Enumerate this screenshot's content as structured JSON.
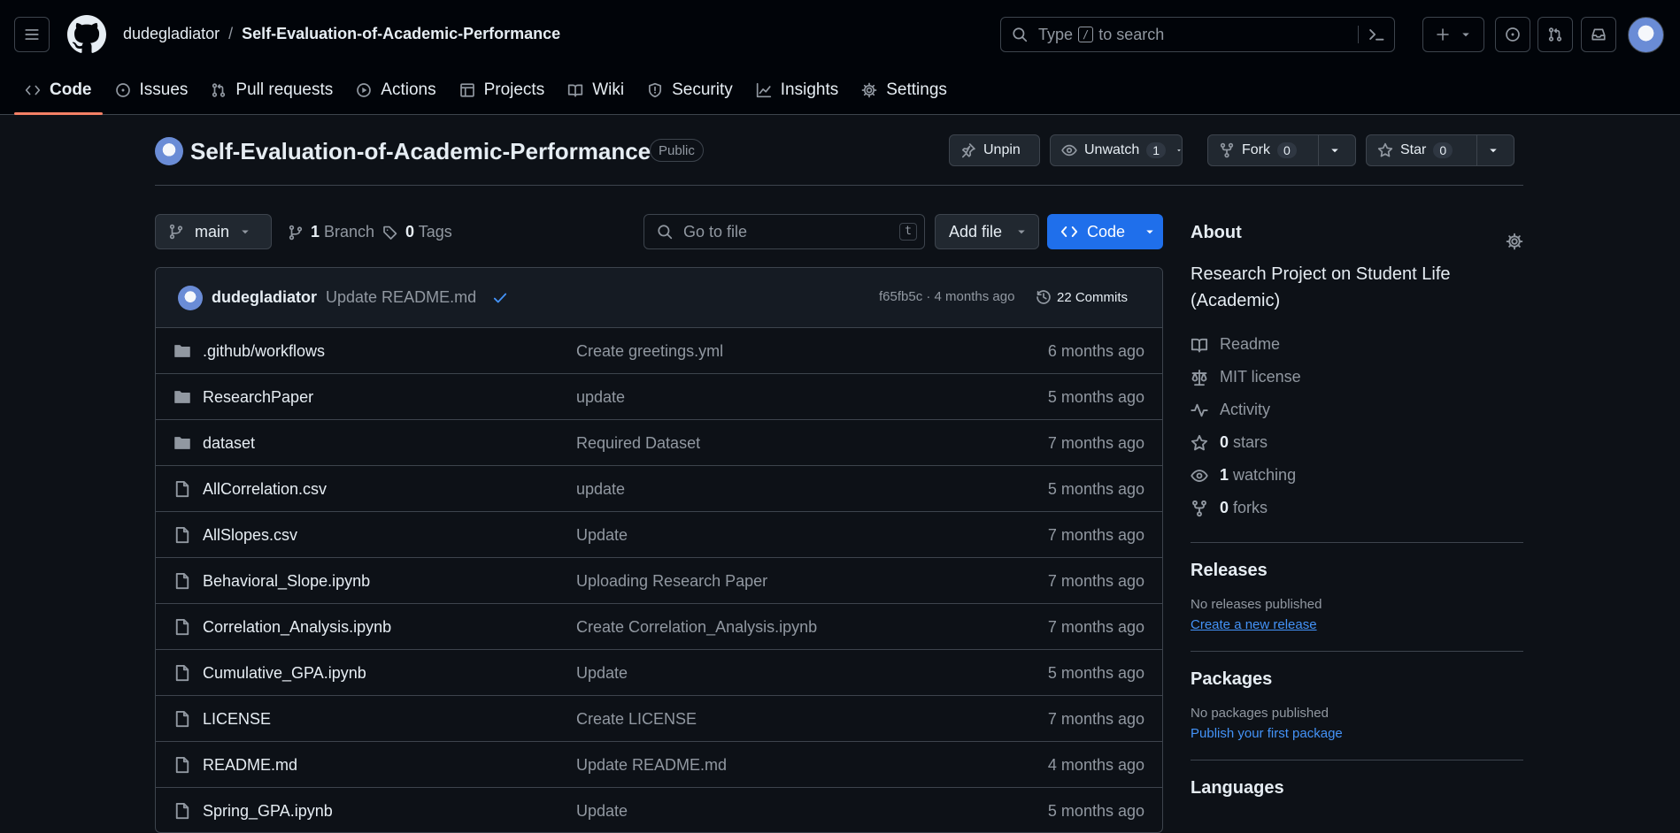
{
  "header": {
    "owner": "dudegladiator",
    "separator": "/",
    "repo": "Self-Evaluation-of-Academic-Performance",
    "search_prefix": "Type",
    "search_key": "/",
    "search_suffix": "to search"
  },
  "tabs": [
    {
      "label": "Code",
      "icon": "code-icon"
    },
    {
      "label": "Issues",
      "icon": "issue-icon"
    },
    {
      "label": "Pull requests",
      "icon": "pull-request-icon"
    },
    {
      "label": "Actions",
      "icon": "play-icon"
    },
    {
      "label": "Projects",
      "icon": "table-icon"
    },
    {
      "label": "Wiki",
      "icon": "book-icon"
    },
    {
      "label": "Security",
      "icon": "shield-icon"
    },
    {
      "label": "Insights",
      "icon": "graph-icon"
    },
    {
      "label": "Settings",
      "icon": "gear-icon"
    }
  ],
  "repo": {
    "title": "Self-Evaluation-of-Academic-Performance",
    "visibility": "Public",
    "unpin": "Unpin",
    "unwatch": "Unwatch",
    "watch_count": "1",
    "fork": "Fork",
    "fork_count": "0",
    "star": "Star",
    "star_count": "0"
  },
  "toolbar": {
    "branch": "main",
    "branch_count": "1",
    "branch_label": "Branch",
    "tag_count": "0",
    "tag_label": "Tags",
    "goto_placeholder": "Go to file",
    "goto_key": "t",
    "add_file": "Add file",
    "code": "Code"
  },
  "commit": {
    "author": "dudegladiator",
    "message": "Update README.md",
    "meta": "f65fb5c · 4 months ago",
    "commits": "22 Commits"
  },
  "files": [
    {
      "name": ".github/workflows",
      "type": "folder",
      "message": "Create greetings.yml",
      "age": "6 months ago"
    },
    {
      "name": "ResearchPaper",
      "type": "folder",
      "message": "update",
      "age": "5 months ago"
    },
    {
      "name": "dataset",
      "type": "folder",
      "message": "Required Dataset",
      "age": "7 months ago"
    },
    {
      "name": "AllCorrelation.csv",
      "type": "file",
      "message": "update",
      "age": "5 months ago"
    },
    {
      "name": "AllSlopes.csv",
      "type": "file",
      "message": "Update",
      "age": "7 months ago"
    },
    {
      "name": "Behavioral_Slope.ipynb",
      "type": "file",
      "message": "Uploading Research Paper",
      "age": "7 months ago"
    },
    {
      "name": "Correlation_Analysis.ipynb",
      "type": "file",
      "message": "Create Correlation_Analysis.ipynb",
      "age": "7 months ago"
    },
    {
      "name": "Cumulative_GPA.ipynb",
      "type": "file",
      "message": "Update",
      "age": "5 months ago"
    },
    {
      "name": "LICENSE",
      "type": "file",
      "message": "Create LICENSE",
      "age": "7 months ago"
    },
    {
      "name": "README.md",
      "type": "file",
      "message": "Update README.md",
      "age": "4 months ago"
    },
    {
      "name": "Spring_GPA.ipynb",
      "type": "file",
      "message": "Update",
      "age": "5 months ago"
    }
  ],
  "about": {
    "heading": "About",
    "description": "Research Project on Student Life (Academic)",
    "readme": "Readme",
    "license": "MIT license",
    "activity": "Activity",
    "stars_count": "0",
    "stars_label": "stars",
    "watching_count": "1",
    "watching_label": "watching",
    "forks_count": "0",
    "forks_label": "forks"
  },
  "releases": {
    "heading": "Releases",
    "empty": "No releases published",
    "link": "Create a new release"
  },
  "packages": {
    "heading": "Packages",
    "empty": "No packages published",
    "link": "Publish your first package"
  },
  "languages": {
    "heading": "Languages"
  },
  "colors": {
    "accent": "#1f6feb",
    "link": "#4493f8",
    "tab_underline": "#f78166",
    "background": "#0d1117"
  }
}
